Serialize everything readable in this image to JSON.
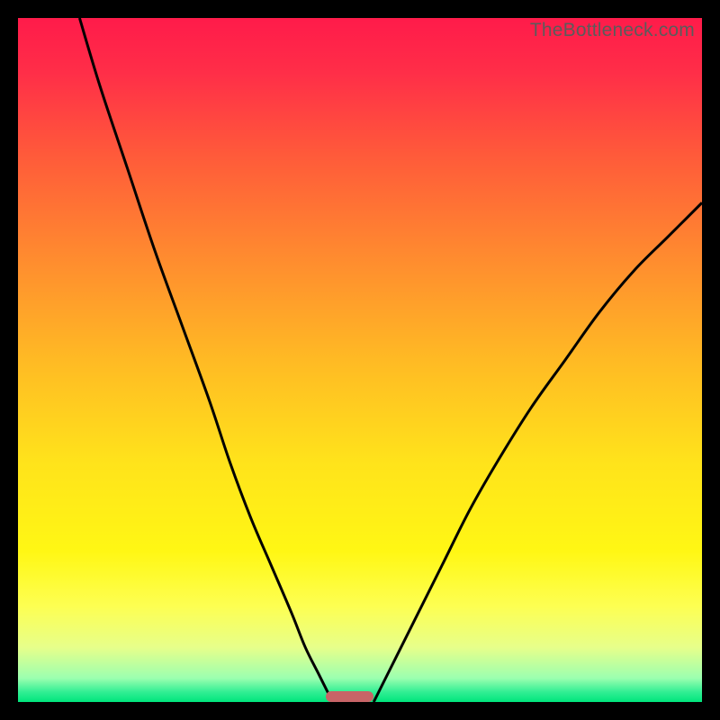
{
  "watermark": "TheBottleneck.com",
  "colors": {
    "background": "#000000",
    "gradient_stops": [
      {
        "offset": 0.0,
        "color": "#ff1b4a"
      },
      {
        "offset": 0.08,
        "color": "#ff2e48"
      },
      {
        "offset": 0.2,
        "color": "#ff5a3a"
      },
      {
        "offset": 0.35,
        "color": "#ff8b2f"
      },
      {
        "offset": 0.5,
        "color": "#ffba24"
      },
      {
        "offset": 0.65,
        "color": "#ffe31b"
      },
      {
        "offset": 0.78,
        "color": "#fff714"
      },
      {
        "offset": 0.86,
        "color": "#fdff52"
      },
      {
        "offset": 0.92,
        "color": "#e7ff8a"
      },
      {
        "offset": 0.965,
        "color": "#9cffb0"
      },
      {
        "offset": 0.985,
        "color": "#33ef94"
      },
      {
        "offset": 1.0,
        "color": "#00e57c"
      }
    ],
    "curve_stroke": "#000000",
    "marker_fill": "#c86467"
  },
  "chart_data": {
    "type": "line",
    "title": "",
    "xlabel": "",
    "ylabel": "",
    "xlim": [
      0,
      100
    ],
    "ylim": [
      0,
      100
    ],
    "series": [
      {
        "name": "left-branch",
        "x": [
          9,
          12,
          16,
          20,
          24,
          28,
          31,
          34,
          37,
          40,
          42,
          44,
          46
        ],
        "y": [
          100,
          90,
          78,
          66,
          55,
          44,
          35,
          27,
          20,
          13,
          8,
          4,
          0
        ]
      },
      {
        "name": "right-branch",
        "x": [
          52,
          55,
          58,
          62,
          66,
          70,
          75,
          80,
          85,
          90,
          95,
          100
        ],
        "y": [
          0,
          6,
          12,
          20,
          28,
          35,
          43,
          50,
          57,
          63,
          68,
          73
        ]
      }
    ],
    "marker": {
      "x_start": 45,
      "x_end": 52,
      "y": 0
    },
    "annotations": []
  }
}
